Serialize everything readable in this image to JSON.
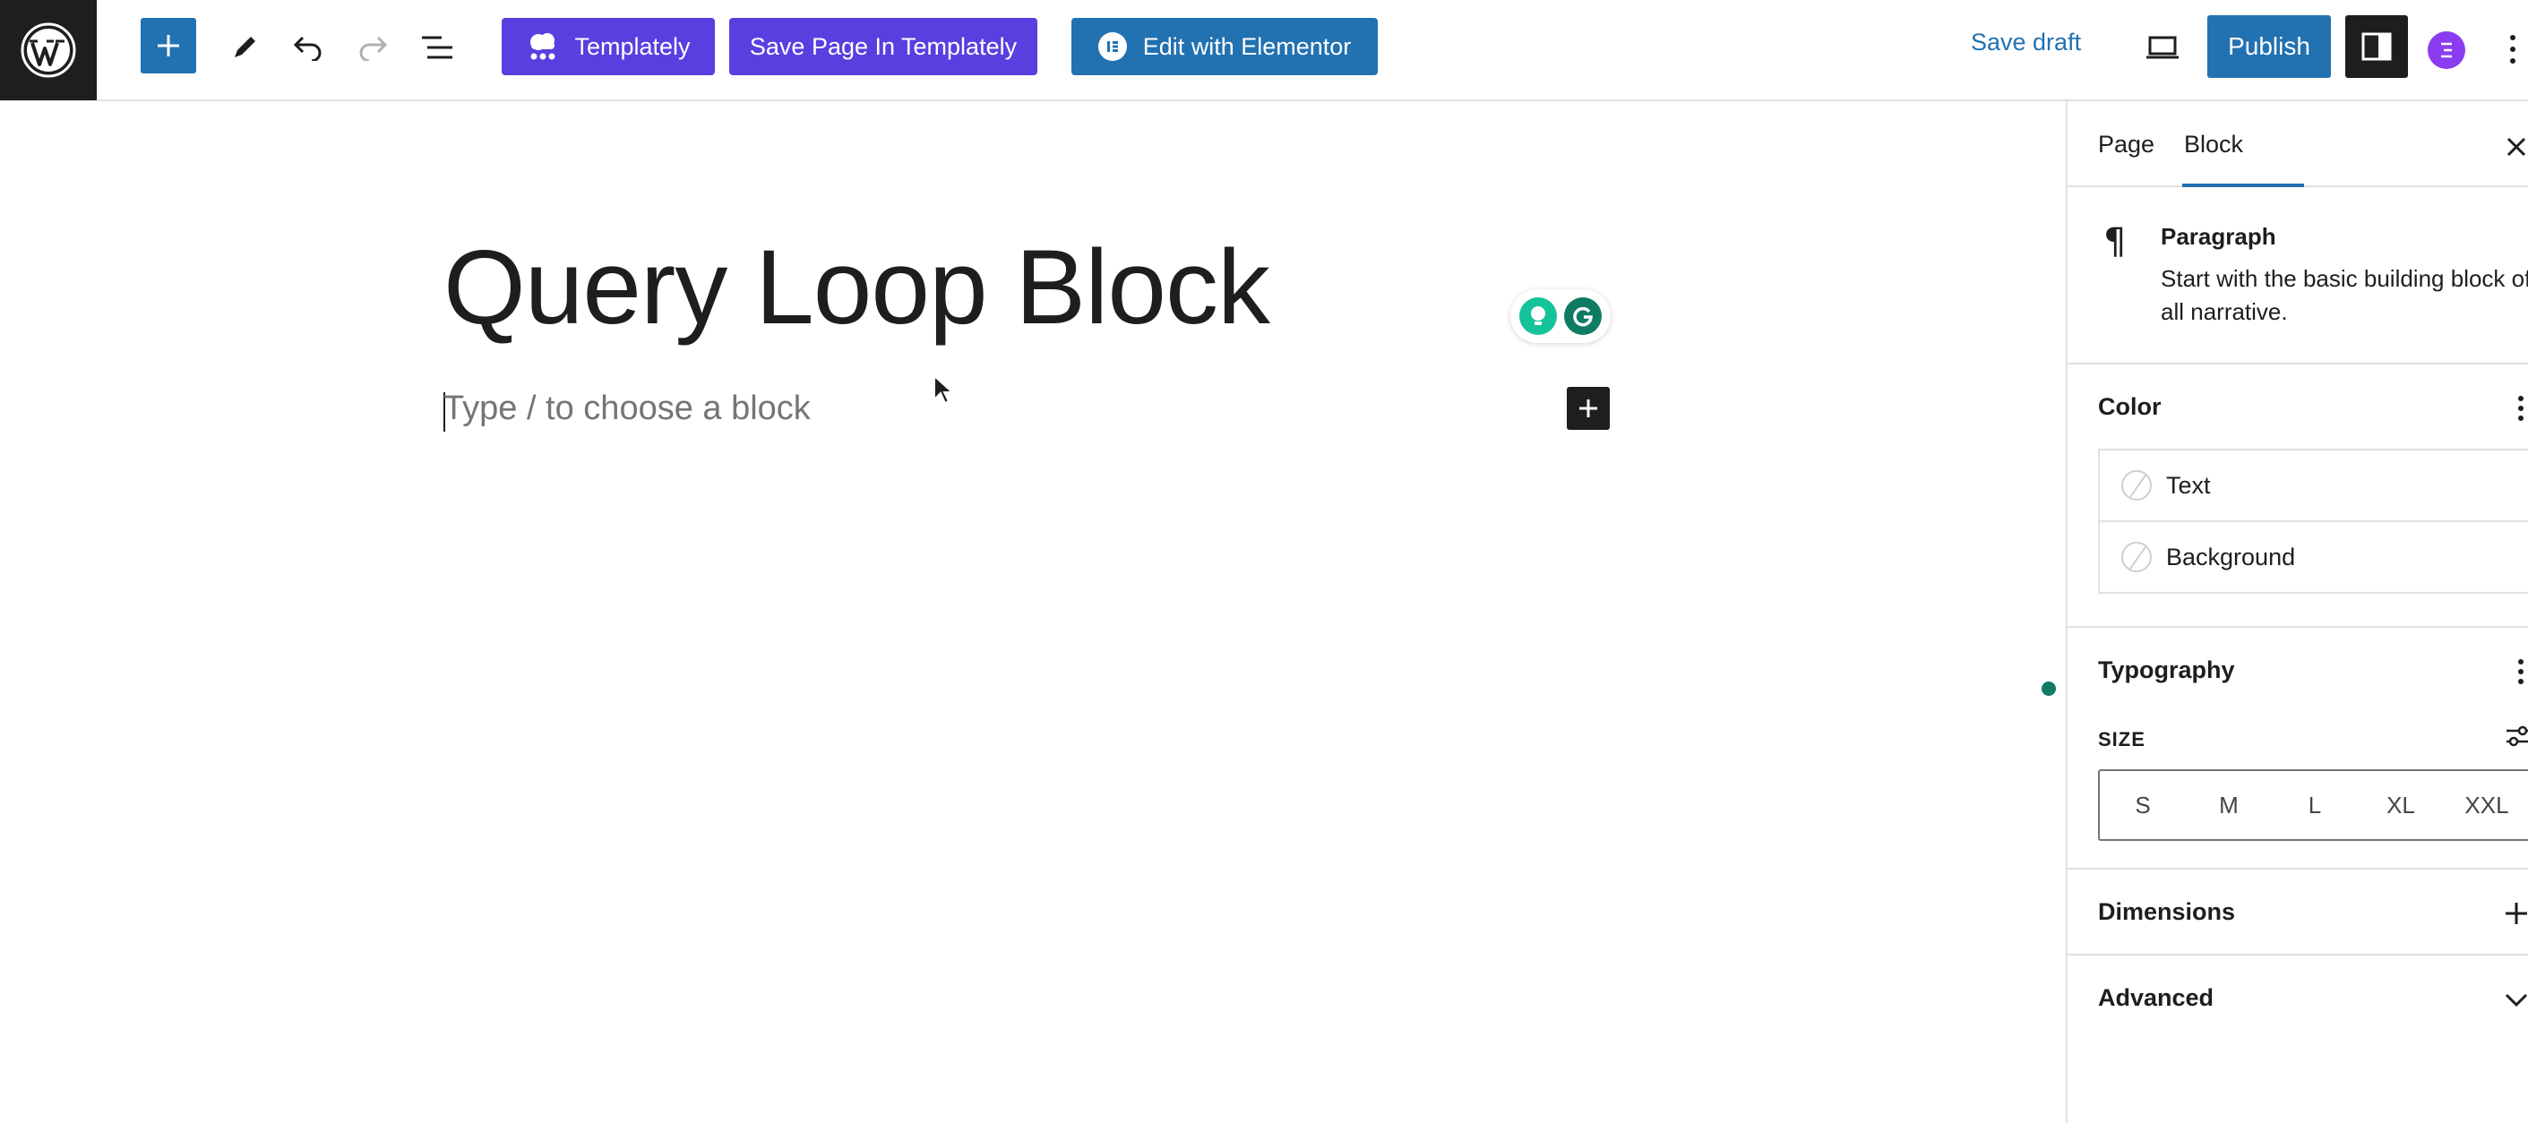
{
  "toolbar": {
    "templately_label": "Templately",
    "save_templately_label": "Save Page In Templately",
    "elementor_label": "Edit with Elementor",
    "save_draft_label": "Save draft",
    "publish_label": "Publish"
  },
  "editor": {
    "title": "Query Loop Block",
    "placeholder": "Type / to choose a block"
  },
  "sidebar": {
    "tabs": [
      "Page",
      "Block"
    ],
    "active_tab": "Block",
    "block": {
      "name": "Paragraph",
      "description": "Start with the basic building block of all narrative."
    },
    "color": {
      "title": "Color",
      "items": [
        "Text",
        "Background"
      ]
    },
    "typography": {
      "title": "Typography",
      "size_label": "SIZE",
      "sizes": [
        "S",
        "M",
        "L",
        "XL",
        "XXL"
      ]
    },
    "dimensions_label": "Dimensions",
    "advanced_label": "Advanced"
  },
  "colors": {
    "wp_blue": "#2271b1",
    "templately_purple": "#5b3ee0",
    "dark": "#1e1e1e",
    "grammarly_green": "#0f7b63"
  }
}
